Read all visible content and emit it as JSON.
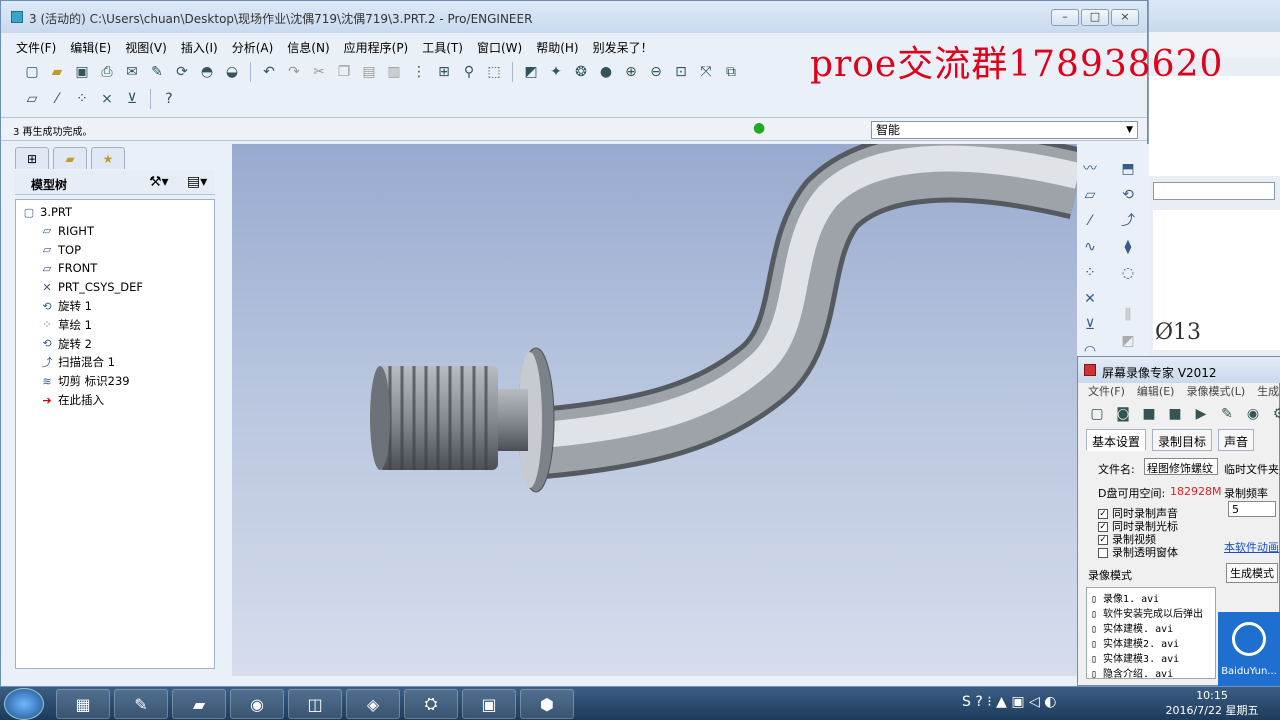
{
  "window": {
    "title": "3 (活动的) C:\\Users\\chuan\\Desktop\\现场作业\\沈偶719\\沈偶719\\3.PRT.2 - Pro/ENGINEER",
    "minimize": "–",
    "maximize": "□",
    "close": "×"
  },
  "menu": [
    "文件(F)",
    "编辑(E)",
    "视图(V)",
    "插入(I)",
    "分析(A)",
    "信息(N)",
    "应用程序(P)",
    "工具(T)",
    "窗口(W)",
    "帮助(H)",
    "别发呆了！"
  ],
  "overlay_text": "proe交流群178938620",
  "status": {
    "message": "3 再生成功完成。",
    "filter": "智能"
  },
  "model_tree": {
    "header": "模型树",
    "items": [
      {
        "label": "3.PRT",
        "icon": "part-icon"
      },
      {
        "label": "RIGHT",
        "icon": "datum-plane-icon"
      },
      {
        "label": "TOP",
        "icon": "datum-plane-icon"
      },
      {
        "label": "FRONT",
        "icon": "datum-plane-icon"
      },
      {
        "label": "PRT_CSYS_DEF",
        "icon": "csys-icon"
      },
      {
        "label": "旋转 1",
        "icon": "revolve-icon"
      },
      {
        "label": "草绘 1",
        "icon": "sketch-icon"
      },
      {
        "label": "旋转 2",
        "icon": "revolve-icon"
      },
      {
        "label": "扫描混合 1",
        "icon": "sweep-blend-icon"
      },
      {
        "label": "切剪 标识239",
        "icon": "cut-icon"
      },
      {
        "label": "在此插入",
        "icon": "insert-here-arrow-icon"
      }
    ]
  },
  "recorder": {
    "title": "屏幕录像专家 V2012",
    "menu": [
      "文件(F)",
      "编辑(E)",
      "录像模式(L)",
      "生成"
    ],
    "tabs": [
      "基本设置",
      "录制目标",
      "声音"
    ],
    "filename_label": "文件名:",
    "filename_value": "程图修饰螺纹",
    "temp_label": "临时文件夹",
    "disk_label": "D盘可用空间:",
    "disk_value": "182928M",
    "rate_label": "录制频率",
    "rate_value": "5",
    "checkboxes": [
      {
        "label": "同时录制声音",
        "checked": true
      },
      {
        "label": "同时录制光标",
        "checked": true
      },
      {
        "label": "录制视频",
        "checked": true
      },
      {
        "label": "录制透明窗体",
        "checked": false
      }
    ],
    "link": "本软件动画",
    "mode_label": "录像模式",
    "gen_mode": "生成模式",
    "files": [
      "录像1. avi",
      "软件安装完成以后弹出",
      "实体建模. avi",
      "实体建模2. avi",
      "实体建模3. avi",
      "隐含介绍. avi"
    ]
  },
  "right_window": {
    "sketch_text": "Ø13"
  },
  "taskbar": {
    "time": "10:15",
    "date": "2016/7/22 星期五",
    "baidu": "BaiduYun..."
  },
  "colors": {
    "overlay": "#e0001a",
    "taskbar": "#1d3b5c"
  }
}
